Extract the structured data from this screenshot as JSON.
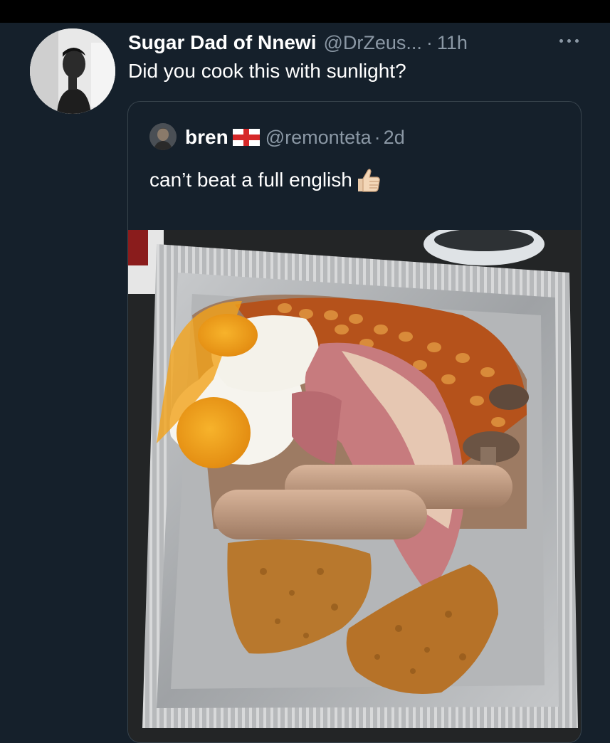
{
  "tweet": {
    "display_name": "Sugar Dad of Nnewi",
    "handle": "@DrZeus...",
    "separator": "·",
    "time": "11h",
    "text": "Did you cook this with sunlight?",
    "more_icon": "more-horizontal-icon"
  },
  "quoted_tweet": {
    "display_name": "bren",
    "flag_icon": "england-flag-icon",
    "handle": "@remonteta",
    "separator": "·",
    "time": "2d",
    "text": "can’t beat a full english",
    "emoji_icon": "thumbs-up-icon",
    "media": "full-english-breakfast-photo"
  },
  "colors": {
    "background": "#15202b",
    "secondary_text": "#8b98a5",
    "border": "#38444d"
  }
}
